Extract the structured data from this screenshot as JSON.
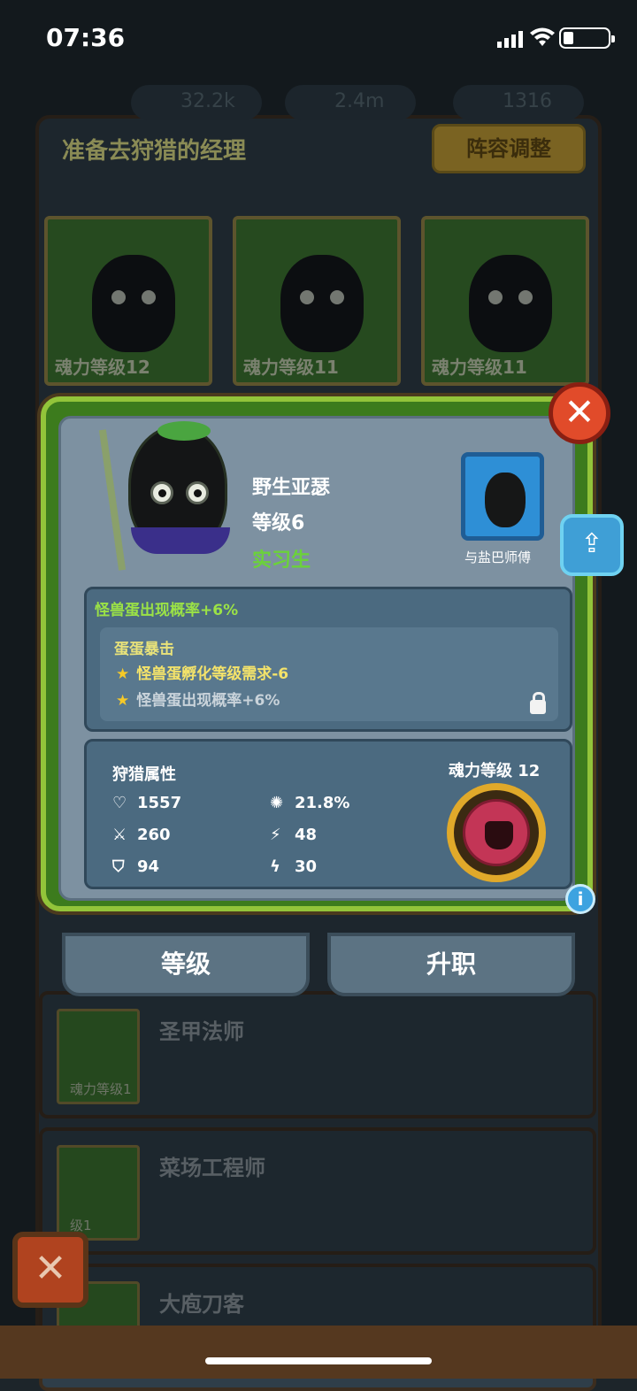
{
  "status": {
    "time": "07:36"
  },
  "currency": [
    {
      "icon": "gem-icon",
      "value": "32.2k"
    },
    {
      "icon": "coin-icon",
      "value": "2.4m"
    },
    {
      "icon": "potion-icon",
      "value": "1316"
    }
  ],
  "header": {
    "title": "准备去狩猎的经理",
    "adjust_button": "阵容调整"
  },
  "slots": [
    {
      "label": "魂力等级12"
    },
    {
      "label": "魂力等级11"
    },
    {
      "label": "魂力等级11"
    }
  ],
  "detail": {
    "name": "野生亚瑟",
    "level": "等级6",
    "rank": "实习生",
    "mentor_label": "与盐巴师傅",
    "bonus": "怪兽蛋出现概率+6%",
    "skill_name": "蛋蛋暴击",
    "skill_lines": [
      {
        "text": "怪兽蛋孵化等级需求-6",
        "color": "#f4e36a"
      },
      {
        "text": "怪兽蛋出现概率+6%",
        "color": "#c9d3da"
      }
    ],
    "attr_title": "狩猎属性",
    "soul_title": "魂力等级 12",
    "stats": {
      "hp": "1557",
      "attack": "260",
      "defense": "94",
      "crit": "21.8%",
      "speed": "48",
      "energy": "30"
    },
    "info_icon": "i",
    "close_icon": "✕"
  },
  "tabs": {
    "level": "等级",
    "promote": "升职"
  },
  "list": [
    {
      "name": "圣甲法师",
      "label": "魂力等级1"
    },
    {
      "name": "菜场工程师",
      "label": "级1"
    },
    {
      "name": "大庖刀客",
      "label": ""
    }
  ],
  "bottom_close": "✕"
}
